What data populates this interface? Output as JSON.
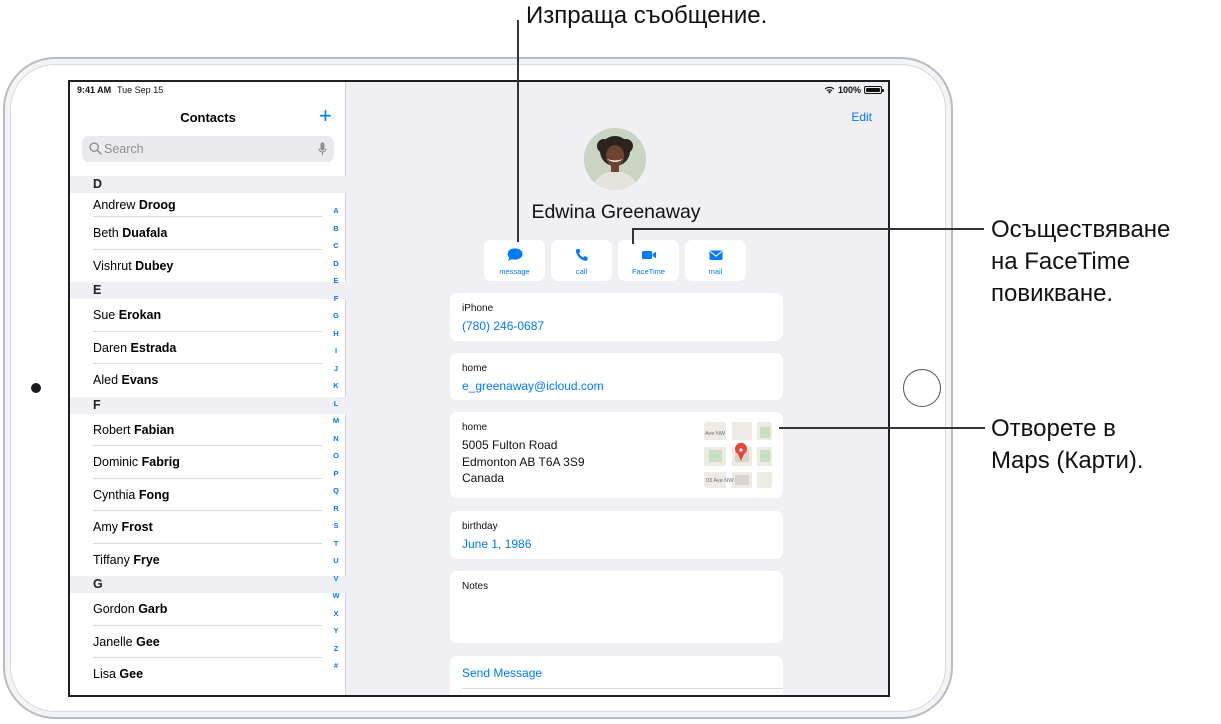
{
  "status_bar": {
    "time": "9:41 AM",
    "date": "Tue Sep 15",
    "battery": "100%"
  },
  "sidebar": {
    "title": "Contacts",
    "add_label": "+",
    "search_placeholder": "Search",
    "sections": [
      {
        "letter": "D",
        "contacts": [
          {
            "first": "Andrew",
            "last": "Droog"
          },
          {
            "first": "Beth",
            "last": "Duafala"
          },
          {
            "first": "Vishrut",
            "last": "Dubey"
          }
        ]
      },
      {
        "letter": "E",
        "contacts": [
          {
            "first": "Sue",
            "last": "Erokan"
          },
          {
            "first": "Daren",
            "last": "Estrada"
          },
          {
            "first": "Aled",
            "last": "Evans"
          }
        ]
      },
      {
        "letter": "F",
        "contacts": [
          {
            "first": "Robert",
            "last": "Fabian"
          },
          {
            "first": "Dominic",
            "last": "Fabrig"
          },
          {
            "first": "Cynthia",
            "last": "Fong"
          },
          {
            "first": "Amy",
            "last": "Frost"
          },
          {
            "first": "Tiffany",
            "last": "Frye"
          }
        ]
      },
      {
        "letter": "G",
        "contacts": [
          {
            "first": "Gordon",
            "last": "Garb"
          },
          {
            "first": "Janelle",
            "last": "Gee"
          },
          {
            "first": "Lisa",
            "last": "Gee"
          }
        ]
      }
    ],
    "index_letters": [
      "A",
      "B",
      "C",
      "D",
      "E",
      "F",
      "G",
      "H",
      "I",
      "J",
      "K",
      "L",
      "M",
      "N",
      "O",
      "P",
      "Q",
      "R",
      "S",
      "T",
      "U",
      "V",
      "W",
      "X",
      "Y",
      "Z",
      "#"
    ]
  },
  "detail": {
    "edit_label": "Edit",
    "name": "Edwina Greenaway",
    "actions": [
      {
        "label": "message",
        "icon": "message-icon"
      },
      {
        "label": "call",
        "icon": "phone-icon"
      },
      {
        "label": "FaceTime",
        "icon": "video-icon"
      },
      {
        "label": "mail",
        "icon": "mail-icon"
      }
    ],
    "phone": {
      "label": "iPhone",
      "value": "(780) 246-0687"
    },
    "email": {
      "label": "home",
      "value": "e_greenaway@icloud.com"
    },
    "address": {
      "label": "home",
      "line1": "5005 Fulton Road",
      "line2": "Edmonton AB T6A 3S9",
      "line3": "Canada",
      "map_text_top": "Ave NW",
      "map_text_bottom": "03 Ave NW"
    },
    "birthday": {
      "label": "birthday",
      "value": "June 1, 1986"
    },
    "notes": {
      "label": "Notes"
    },
    "send_message_label": "Send Message"
  },
  "callouts": {
    "message": "Изпраща съобщение.",
    "facetime": [
      "Осъществяване",
      "на FaceTime",
      "повикване."
    ],
    "maps": [
      "Отворете в",
      "Maps (Карти)."
    ]
  },
  "colors": {
    "accent": "#007aff",
    "map_pin": "#e5453a"
  }
}
